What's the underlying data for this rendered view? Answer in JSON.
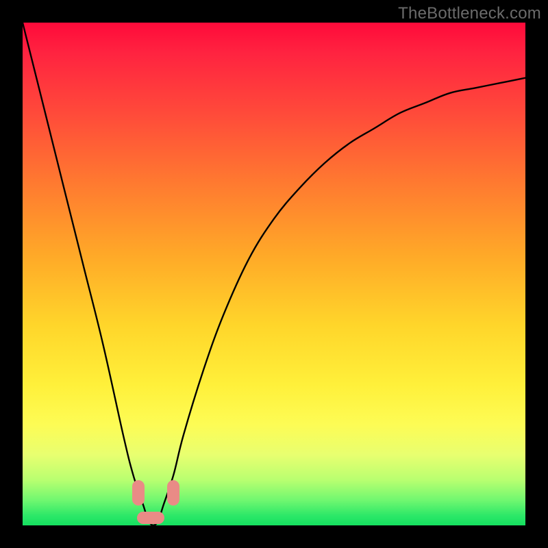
{
  "watermark": "TheBottleneck.com",
  "chart_data": {
    "type": "line",
    "title": "",
    "xlabel": "",
    "ylabel": "",
    "xlim": [
      0,
      100
    ],
    "ylim": [
      0,
      100
    ],
    "grid": false,
    "legend": false,
    "series": [
      {
        "name": "bottleneck-curve",
        "x": [
          0,
          4,
          8,
          12,
          16,
          20,
          22,
          24,
          25,
          26,
          27,
          28,
          30,
          32,
          36,
          40,
          45,
          50,
          55,
          60,
          65,
          70,
          75,
          80,
          85,
          90,
          95,
          100
        ],
        "values": [
          100,
          84,
          68,
          52,
          36,
          18,
          10,
          4,
          1,
          0,
          1,
          4,
          10,
          18,
          31,
          42,
          53,
          61,
          67,
          72,
          76,
          79,
          82,
          84,
          86,
          87,
          88,
          89
        ]
      }
    ],
    "markers": [
      {
        "name": "valley-left",
        "x": 23.0,
        "y": 6.5,
        "w": 2.5,
        "h": 5.0
      },
      {
        "name": "valley-bottom",
        "x": 25.5,
        "y": 1.5,
        "w": 5.5,
        "h": 2.5
      },
      {
        "name": "valley-right",
        "x": 30.0,
        "y": 6.5,
        "w": 2.5,
        "h": 5.0
      }
    ],
    "gradient_stops": [
      {
        "pos": 0,
        "color": "#ff0a3a"
      },
      {
        "pos": 18,
        "color": "#ff4a3a"
      },
      {
        "pos": 46,
        "color": "#ffa828"
      },
      {
        "pos": 72,
        "color": "#fff03a"
      },
      {
        "pos": 91,
        "color": "#b8ff70"
      },
      {
        "pos": 100,
        "color": "#15e060"
      }
    ]
  }
}
